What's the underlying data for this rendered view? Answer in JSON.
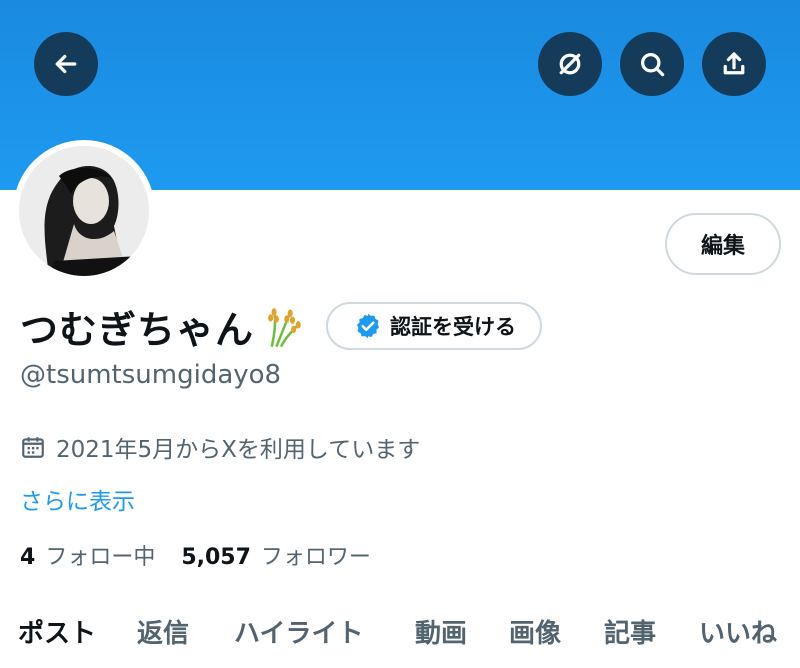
{
  "header": {
    "back_icon": "arrow-left-icon",
    "actions": [
      {
        "name": "circle-slash-icon"
      },
      {
        "name": "search-icon"
      },
      {
        "name": "share-upload-icon"
      }
    ],
    "banner_color": "#1d9bf0"
  },
  "profile": {
    "display_name": "つむぎちゃん",
    "name_emoji": "rice-sheaf-icon",
    "verify_label": "認証を受ける",
    "handle": "@tsumtsumgidayo8",
    "joined": "2021年5月からXを利用しています",
    "show_more": "さらに表示",
    "following_count": "4",
    "following_label": "フォロー中",
    "followers_count": "5,057",
    "followers_label": "フォロワー",
    "edit_label": "編集"
  },
  "tabs": [
    {
      "label": "ポスト",
      "active": true
    },
    {
      "label": "返信",
      "active": false
    },
    {
      "label": "ハイライト",
      "active": false
    },
    {
      "label": "動画",
      "active": false
    },
    {
      "label": "画像",
      "active": false
    },
    {
      "label": "記事",
      "active": false
    },
    {
      "label": "いいね",
      "active": false
    }
  ],
  "colors": {
    "accent": "#1d9bf0",
    "text": "#0f1419",
    "muted": "#536471",
    "border": "#cfd9de"
  }
}
